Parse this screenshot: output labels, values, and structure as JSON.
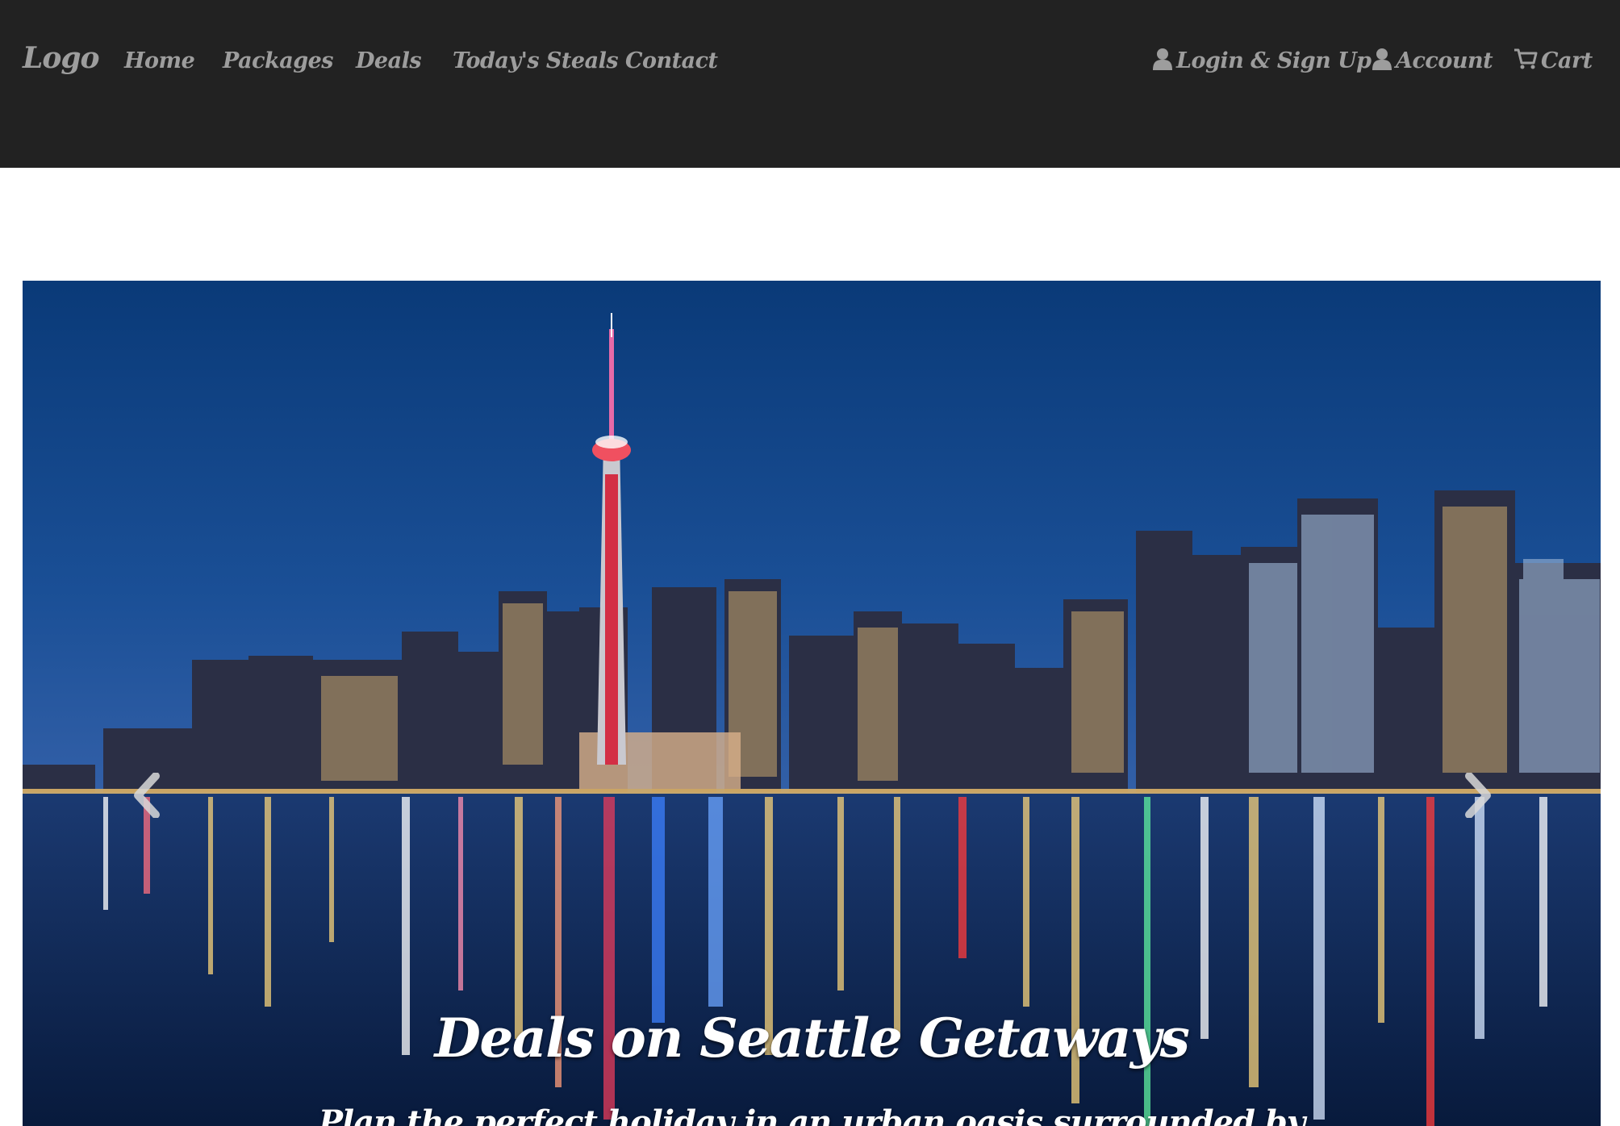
{
  "navbar": {
    "brand": "Logo",
    "links": [
      {
        "label": "Home"
      },
      {
        "label": "Packages"
      },
      {
        "label": "Deals"
      },
      {
        "label": "Today's Steals"
      },
      {
        "label": "Contact"
      }
    ],
    "right": {
      "login": {
        "label": "Login & Sign Up",
        "icon": "user-icon"
      },
      "account": {
        "label": "Account",
        "icon": "user-icon"
      },
      "cart": {
        "label": "Cart",
        "icon": "shopping-cart-icon"
      }
    }
  },
  "carousel": {
    "image": "city-skyline-night-image",
    "prev_icon": "chevron-left-icon",
    "next_icon": "chevron-right-icon",
    "caption": {
      "title": "Deals on Seattle Getaways",
      "text": "Plan the perfect holiday in an urban oasis surrounded by"
    }
  },
  "colors": {
    "navbar_bg": "#222222",
    "nav_text": "#9d9d9d",
    "caption_text": "#ffffff",
    "sky_top": "#0a3a78",
    "water": "#0a2550"
  }
}
